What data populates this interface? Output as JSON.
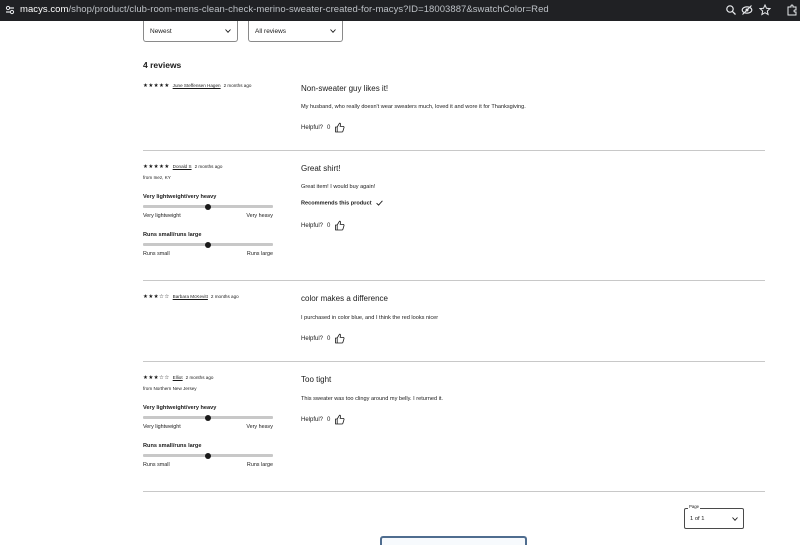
{
  "browser": {
    "url_host": "macys.com",
    "url_path": "/shop/product/club-room-mens-clean-check-merino-sweater-created-for-macys?ID=18003887&swatchColor=Red"
  },
  "filters": {
    "sort_value": "Newest",
    "rating_value": "All reviews"
  },
  "reviews_count": "4 reviews",
  "helpful_label": "Helpful?",
  "recommends_label": "Recommends this product",
  "reviews": [
    {
      "stars": 5,
      "author": "June Steffensen Hagen",
      "time_ago": "2 months ago",
      "location": "",
      "title": "Non-sweater guy likes it!",
      "body": "My husband, who really doesn't wear sweaters much, loved it and wore it for Thanksgiving.",
      "helpful_count": "0"
    },
    {
      "stars": 5,
      "author": "Donald S",
      "time_ago": "2 months ago",
      "location": "from Inez, KY",
      "title": "Great shirt!",
      "body": "Great item! I would buy again!",
      "recommends": true,
      "helpful_count": "0",
      "weight": {
        "label": "Very lightweight/very heavy",
        "left": "Very lightweight",
        "right": "Very heavy",
        "value_percent": 50
      },
      "fit": {
        "label": "Runs small/runs large",
        "left": "Runs small",
        "right": "Runs large",
        "value_percent": 50
      }
    },
    {
      "stars": 3,
      "author": "Barbara McKevitt",
      "time_ago": "2 months ago",
      "location": "",
      "title": "color makes a difference",
      "body": "I purchased in color blue, and I think the red looks nicer",
      "helpful_count": "0"
    },
    {
      "stars": 3,
      "author": "Elliot",
      "time_ago": "2 months ago",
      "location": "from Northern New Jersey",
      "title": "Too tight",
      "body": "This sweater was too clingy around my belly. I returned it.",
      "helpful_count": "0",
      "weight": {
        "label": "Very lightweight/very heavy",
        "left": "Very lightweight",
        "right": "Very heavy",
        "value_percent": 50
      },
      "fit": {
        "label": "Runs small/runs large",
        "left": "Runs small",
        "right": "Runs large",
        "value_percent": 50
      }
    }
  ],
  "pagination": {
    "legend": "Page",
    "value": "1 of 1"
  },
  "colors": {
    "urlbar_bg": "#202124",
    "text": "#1a1a1a",
    "divider": "#c8c8c8"
  }
}
